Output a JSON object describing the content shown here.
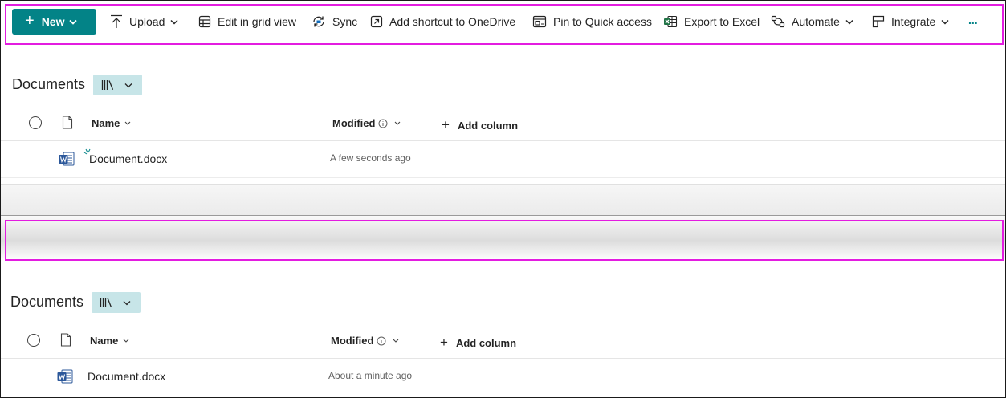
{
  "colors": {
    "accent": "#038387",
    "highlight": "#e31ce0",
    "view_bg": "#c7e5e8"
  },
  "toolbar": {
    "new_label": "New",
    "items": [
      {
        "label": "Upload",
        "icon": "upload-icon",
        "dropdown": true
      },
      {
        "label": "Edit in grid view",
        "icon": "grid-icon"
      },
      {
        "label": "Sync",
        "icon": "sync-icon"
      },
      {
        "label": "Add shortcut to OneDrive",
        "icon": "shortcut-icon"
      },
      {
        "label": "Pin to Quick access",
        "icon": "pin-icon"
      },
      {
        "label": "Export to Excel",
        "icon": "excel-icon"
      },
      {
        "label": "Automate",
        "icon": "automate-icon",
        "dropdown": true
      },
      {
        "label": "Integrate",
        "icon": "integrate-icon",
        "dropdown": true
      }
    ],
    "more_label": "..."
  },
  "panel1": {
    "title": "Documents",
    "columns": {
      "name": "Name",
      "modified": "Modified",
      "add": "Add column"
    },
    "rows": [
      {
        "name": "Document.docx",
        "modified": "A few seconds ago"
      }
    ]
  },
  "panel2": {
    "title": "Documents",
    "columns": {
      "name": "Name",
      "modified": "Modified",
      "add": "Add column"
    },
    "rows": [
      {
        "name": "Document.docx",
        "modified": "About a minute ago"
      }
    ]
  }
}
